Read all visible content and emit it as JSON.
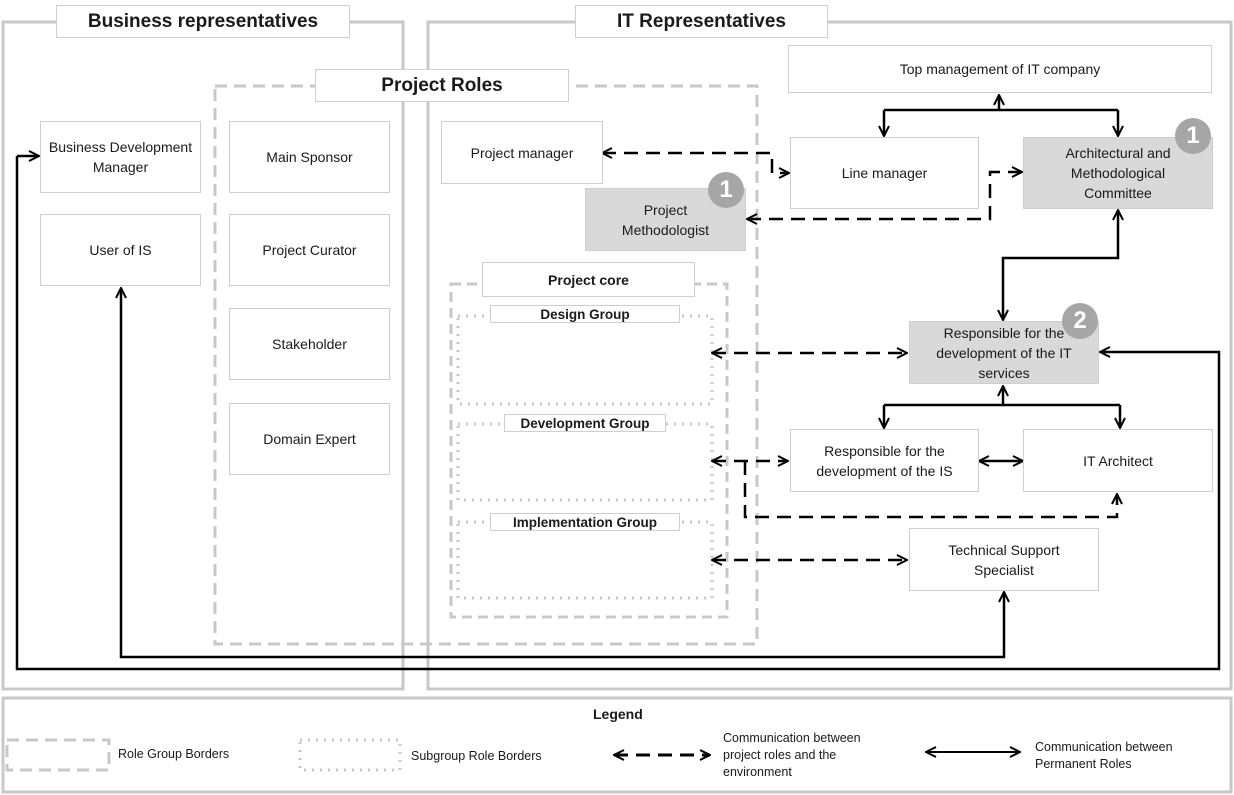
{
  "groups": {
    "business": "Business representatives",
    "it": "IT Representatives",
    "project_roles": "Project Roles",
    "project_core": "Project core",
    "design_group": "Design Group",
    "development_group": "Development Group",
    "implementation_group": "Implementation Group"
  },
  "roles": {
    "business_dev_manager": "Business Development Manager",
    "user_of_is": "User of IS",
    "main_sponsor": "Main Sponsor",
    "project_curator": "Project Curator",
    "stakeholder": "Stakeholder",
    "domain_expert": "Domain Expert",
    "project_manager": "Project manager",
    "project_methodologist": "Project Methodologist",
    "top_management": "Top management of IT company",
    "line_manager": "Line manager",
    "arch_committee": "Architectural and Methodological Committee",
    "resp_it_services": "Responsible for the development of the IT services",
    "resp_is": "Responsible for the development of the IS",
    "it_architect": "IT Architect",
    "tech_support": "Technical Support Specialist"
  },
  "badges": {
    "project_methodologist": "1",
    "arch_committee": "1",
    "resp_it_services": "2"
  },
  "legend": {
    "title": "Legend",
    "role_group_borders": "Role Group Borders",
    "subgroup_role_borders": "Subgroup Role Borders",
    "dashed_arrow": "Communication between project roles and the environment",
    "solid_arrow": "Communication between Permanent Roles"
  },
  "colors": {
    "border_grey": "#c8c8c8",
    "highlight_box": "#d9d9d9",
    "badge": "#a6a6a6",
    "arrow": "#000000"
  }
}
